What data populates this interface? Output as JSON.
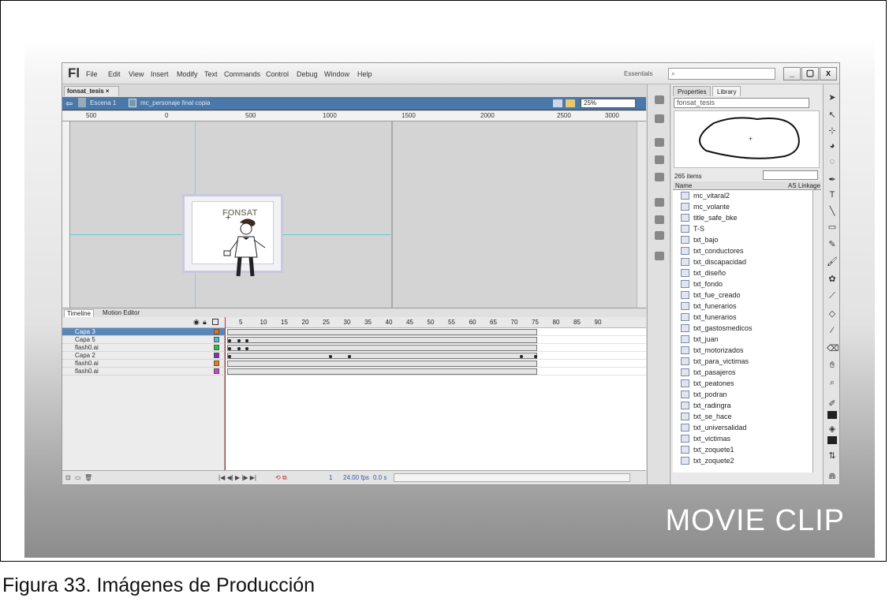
{
  "app": {
    "logo": "Fl",
    "menus": [
      "File",
      "Edit",
      "View",
      "Insert",
      "Modify",
      "Text",
      "Commands",
      "Control",
      "Debug",
      "Window",
      "Help"
    ],
    "workspace": "Essentials",
    "search_placeholder": "⌕"
  },
  "window_buttons": [
    "_",
    "▢",
    "x"
  ],
  "document": {
    "tab": "fonsat_tesis ×",
    "scene": "Escena 1",
    "symbol": "mc_personaje final copia",
    "zoom": "25%"
  },
  "ruler": [
    "500",
    "0",
    "500",
    "1000",
    "1500",
    "2000",
    "2500",
    "3000"
  ],
  "stage": {
    "watermark": "FONSAT"
  },
  "timeline": {
    "tabs": [
      "Timeline",
      "Motion Editor"
    ],
    "frame_numbers": [
      "5",
      "10",
      "15",
      "20",
      "25",
      "30",
      "35",
      "40",
      "45",
      "50",
      "55",
      "60",
      "65",
      "70",
      "75",
      "80",
      "85",
      "90"
    ],
    "layers": [
      {
        "name": "Capa 3",
        "color": "#f07000",
        "selected": true
      },
      {
        "name": "Capa 5",
        "color": "#40c0d0"
      },
      {
        "name": "flash0.ai",
        "color": "#30c040"
      },
      {
        "name": "Capa 2",
        "color": "#8030c0"
      },
      {
        "name": "flash0.ai",
        "color": "#f08000"
      },
      {
        "name": "flash0.ai",
        "color": "#d040d0"
      }
    ],
    "status": {
      "frame": "1",
      "fps": "24.00 fps",
      "time": "0.0 s"
    }
  },
  "library": {
    "tabs": [
      "Properties",
      "Library"
    ],
    "file": "fonsat_tesis",
    "count": "265 items",
    "columns": [
      "Name",
      "AS Linkage"
    ],
    "items": [
      "mc_vitaral2",
      "mc_volante",
      "title_safe_bke",
      "T-S",
      "txt_bajo",
      "txt_conductores",
      "txt_discapacidad",
      "txt_diseño",
      "txt_fondo",
      "txt_fue_creado",
      "txt_funerarios",
      "txt_funerarios",
      "txt_gastosmedicos",
      "txt_juan",
      "txt_motorizados",
      "txt_para_victimas",
      "txt_pasajeros",
      "txt_peatones",
      "txt_podran",
      "txt_radingra",
      "txt_se_hace",
      "txt_universalidad",
      "txt_victimas",
      "txt_zoquete1",
      "txt_zoquete2"
    ]
  },
  "slide_title": "MOVIE CLIP",
  "caption": "Figura 33. Imágenes de Producción"
}
